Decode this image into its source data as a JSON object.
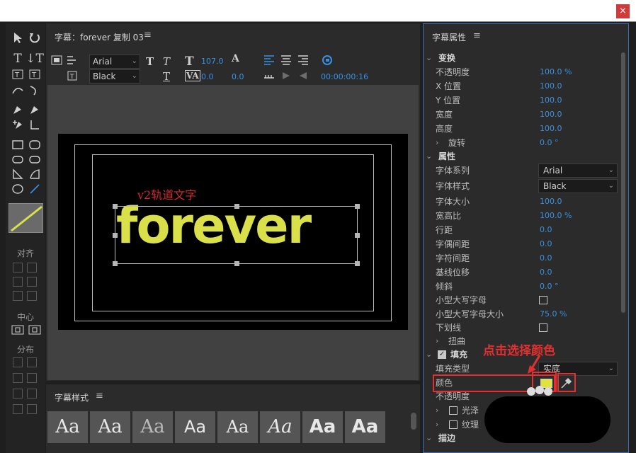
{
  "window": {
    "close_label": "×"
  },
  "center": {
    "title": "字幕：forever 复制 03",
    "menu": "≡",
    "font_family": "Arial",
    "font_style": "Black",
    "font_size": "107.0",
    "tracking": "0.0",
    "kerning": "0.0",
    "leading": "0.0",
    "timecode": "00:00:00:16"
  },
  "stage": {
    "v2_label": "v2轨道文字",
    "main_text": "forever"
  },
  "left": {
    "align_label": "对齐",
    "center_label": "中心",
    "distribute_label": "分布"
  },
  "styles": {
    "title": "字幕样式",
    "menu": "≡",
    "swatch_text": "Aa"
  },
  "props": {
    "title": "字幕属性",
    "menu": "≡",
    "transform": "变换",
    "opacity_label": "不透明度",
    "opacity": "100.0 %",
    "x_label": "X 位置",
    "x": "100.0",
    "y_label": "Y 位置",
    "y": "100.0",
    "w_label": "宽度",
    "w": "100.0",
    "h_label": "高度",
    "h": "100.0",
    "rot_label": "旋转",
    "rot": "0.0 °",
    "attributes": "属性",
    "family_label": "字体系列",
    "family": "Arial",
    "style_label": "字体样式",
    "style": "Black",
    "size_label": "字体大小",
    "size": "100.0",
    "aspect_label": "宽高比",
    "aspect": "100.0 %",
    "leading_label": "行距",
    "leading": "0.0",
    "kerning_label": "字偶间距",
    "kerning": "0.0",
    "tracking_label": "字符间距",
    "tracking": "0.0",
    "baseline_label": "基线位移",
    "baseline": "0.0",
    "slant_label": "倾斜",
    "slant": "0.0 °",
    "smallcaps_label": "小型大写字母",
    "smallcaps_size_label": "小型大写字母大小",
    "smallcaps_size": "75.0 %",
    "underline_label": "下划线",
    "distort_label": "扭曲",
    "fill_label": "填充",
    "fill_type_label": "填充类型",
    "fill_type": "实底",
    "color_label": "颜色",
    "fill_opacity_label": "不透明度",
    "sheen_label": "光泽",
    "texture_label": "纹理",
    "stroke_label": "描边"
  },
  "annotation": {
    "text": "点击选择颜色"
  },
  "colors": {
    "accent": "#3b91e0",
    "fill_color": "#e2e23c",
    "annotation": "#e23030"
  }
}
